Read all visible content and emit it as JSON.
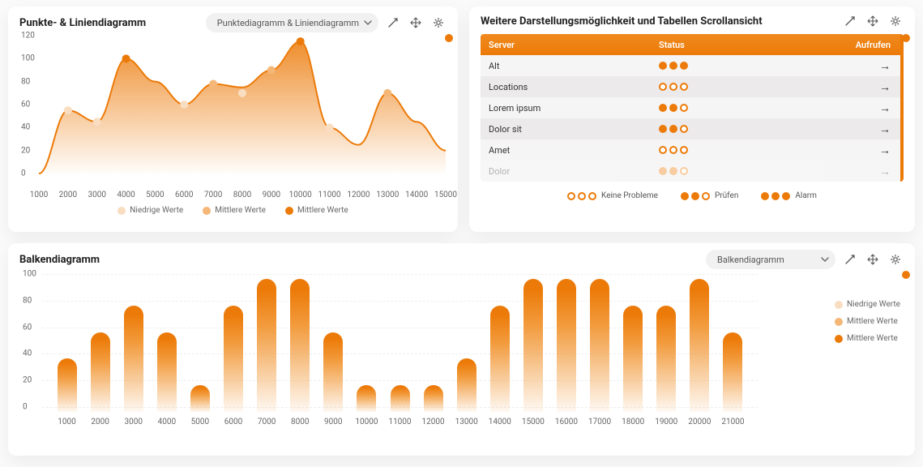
{
  "colors": {
    "accent": "#EC7A08",
    "low": "#F9DDC1",
    "mid": "#F4B777",
    "high": "#EC7A08"
  },
  "card1": {
    "title": "Punkte- & Liniendiagramm",
    "select": "Punktediagramm & Liniendiagramm",
    "legend": [
      "Niedrige Werte",
      "Mittlere Werte",
      "Mittlere Werte"
    ]
  },
  "card2": {
    "title": "Weitere Darstellungsmöglichkeit und Tabellen Scrollansicht",
    "head": {
      "server": "Server",
      "status": "Status",
      "open": "Aufrufen"
    },
    "rows": [
      {
        "name": "Alt",
        "status": [
          1,
          1,
          1
        ]
      },
      {
        "name": "Locations",
        "status": [
          0,
          0,
          0
        ]
      },
      {
        "name": "Lorem ipsum",
        "status": [
          1,
          1,
          0
        ]
      },
      {
        "name": "Dolor sit",
        "status": [
          1,
          1,
          0
        ]
      },
      {
        "name": "Amet",
        "status": [
          0,
          0,
          0
        ]
      },
      {
        "name": "Dolor",
        "status": [
          1,
          1,
          0
        ],
        "faded": true
      }
    ],
    "legend": [
      {
        "label": "Keine Probleme",
        "pattern": [
          0,
          0,
          0
        ]
      },
      {
        "label": "Prüfen",
        "pattern": [
          1,
          1,
          0
        ]
      },
      {
        "label": "Alarm",
        "pattern": [
          1,
          1,
          1
        ]
      }
    ]
  },
  "card3": {
    "title": "Balkendiagramm",
    "select": "Balkendiagramm",
    "legend": [
      "Niedrige Werte",
      "Mittlere Werte",
      "Mittlere Werte"
    ]
  },
  "chart_data": [
    {
      "type": "area",
      "title": "Punkte- & Liniendiagramm",
      "x": [
        1000,
        2000,
        3000,
        4000,
        5000,
        6000,
        7000,
        8000,
        9000,
        10000,
        11000,
        12000,
        13000,
        14000,
        15000
      ],
      "values": [
        0,
        55,
        45,
        100,
        80,
        60,
        78,
        75,
        90,
        115,
        40,
        25,
        70,
        45,
        20
      ],
      "scatter": [
        {
          "x": 2000,
          "y": 55,
          "series": "low"
        },
        {
          "x": 3000,
          "y": 45,
          "series": "low"
        },
        {
          "x": 4000,
          "y": 100,
          "series": "high"
        },
        {
          "x": 6000,
          "y": 60,
          "series": "low"
        },
        {
          "x": 7000,
          "y": 78,
          "series": "mid"
        },
        {
          "x": 8000,
          "y": 70,
          "series": "low"
        },
        {
          "x": 9000,
          "y": 90,
          "series": "mid"
        },
        {
          "x": 10000,
          "y": 115,
          "series": "high"
        },
        {
          "x": 11000,
          "y": 40,
          "series": "low"
        },
        {
          "x": 13000,
          "y": 70,
          "series": "mid"
        }
      ],
      "xlabel": "",
      "ylabel": "",
      "xlim": [
        1000,
        15000
      ],
      "ylim": [
        0,
        120
      ],
      "yticks": [
        0,
        20,
        40,
        60,
        80,
        100,
        120
      ],
      "legend": [
        "Niedrige Werte",
        "Mittlere Werte",
        "Mittlere Werte"
      ]
    },
    {
      "type": "bar",
      "title": "Balkendiagramm",
      "categories": [
        1000,
        2000,
        3000,
        4000,
        5000,
        6000,
        7000,
        8000,
        9000,
        10000,
        11000,
        12000,
        13000,
        14000,
        15000,
        16000,
        17000,
        18000,
        19000,
        20000,
        21000
      ],
      "values": [
        40,
        60,
        80,
        60,
        20,
        80,
        100,
        100,
        60,
        20,
        20,
        20,
        40,
        80,
        100,
        100,
        100,
        80,
        80,
        100,
        60
      ],
      "xlabel": "",
      "ylabel": "",
      "ylim": [
        0,
        100
      ],
      "yticks": [
        0,
        20,
        40,
        60,
        80,
        100
      ],
      "legend": [
        "Niedrige Werte",
        "Mittlere Werte",
        "Mittlere Werte"
      ]
    }
  ]
}
